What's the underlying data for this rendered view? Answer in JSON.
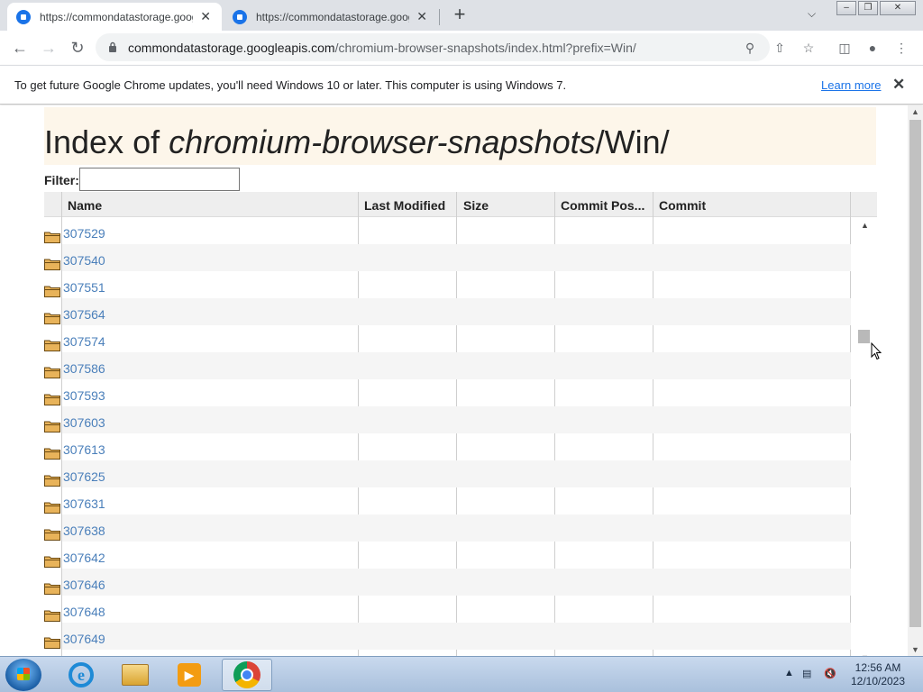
{
  "browser": {
    "tabs": [
      {
        "title": "https://commondatastorage.googleapis.com",
        "close": "✕",
        "active": true
      },
      {
        "title": "https://commondatastorage.googleapis.com",
        "close": "✕",
        "active": false
      }
    ],
    "new_tab_label": "+",
    "tab_list_icon": "chevron-down-icon",
    "window_controls": [
      "minimize",
      "restore",
      "close"
    ],
    "address": {
      "host": "commondatastorage.googleapis.com",
      "path": "/chromium-browser-snapshots/index.html?prefix=Win/"
    },
    "toolbar_icons": [
      "search-icon",
      "share-icon",
      "star-icon",
      "side-panel-icon",
      "profile-icon",
      "menu-icon"
    ]
  },
  "infobar": {
    "message": "To get future Google Chrome updates, you'll need Windows 10 or later. This computer is using Windows 7.",
    "link": "Learn more",
    "close": "✕"
  },
  "page": {
    "title_prefix": "Index of ",
    "title_path": "chromium-browser-snapshots",
    "title_suffix": "/Win/",
    "filter_label": "Filter:",
    "filter_value": "",
    "columns": [
      "Name",
      "Last Modified",
      "Size",
      "Commit Pos...",
      "Commit"
    ],
    "rows": [
      "307529",
      "307540",
      "307551",
      "307564",
      "307574",
      "307586",
      "307593",
      "307603",
      "307613",
      "307625",
      "307631",
      "307638",
      "307642",
      "307646",
      "307648",
      "307649"
    ]
  },
  "taskbar": {
    "apps": [
      "start-button",
      "internet-explorer",
      "windows-explorer",
      "media-player",
      "google-chrome"
    ],
    "active_app": "google-chrome",
    "clock_time": "12:56 AM",
    "clock_date": "12/10/2023"
  }
}
